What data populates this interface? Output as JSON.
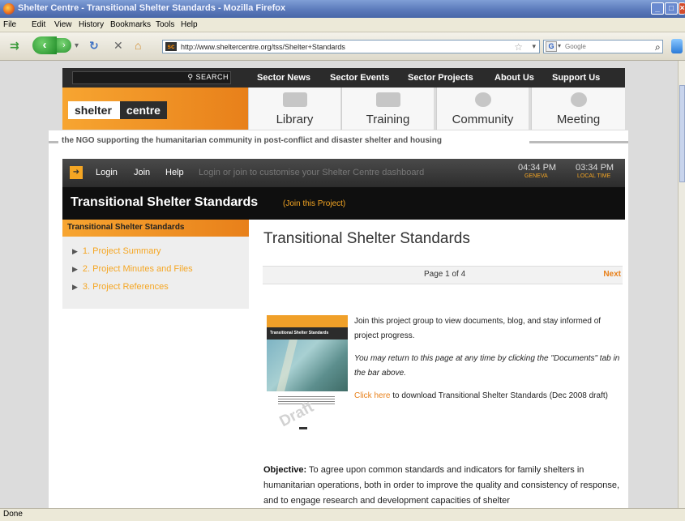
{
  "window": {
    "title": "Shelter Centre - Transitional Shelter Standards - Mozilla Firefox"
  },
  "menu": [
    "File",
    "Edit",
    "View",
    "History",
    "Bookmarks",
    "Tools",
    "Help"
  ],
  "toolbar": {
    "url": "http://www.sheltercentre.org/tss/Shelter+Standards",
    "search_placeholder": "Google"
  },
  "site": {
    "search_button": "SEARCH",
    "top_nav": [
      "Sector News",
      "Sector Events",
      "Sector Projects",
      "About Us",
      "Support Us"
    ],
    "logo_left": "shelter",
    "logo_right": "centre",
    "tabs": [
      "Library",
      "Training",
      "Community",
      "Meeting"
    ],
    "tagline": "the NGO supporting the humanitarian community in post-conflict and disaster shelter and housing",
    "user_bar": {
      "icon": "➜",
      "login": "Login",
      "join": "Join",
      "help": "Help",
      "message": "Login or join to customise your Shelter Centre dashboard",
      "time_geneva": "04:34 PM",
      "geneva_label": "GENEVA",
      "time_local": "03:34 PM",
      "local_label": "LOCAL TIME"
    },
    "project": {
      "title": "Transitional Shelter Standards",
      "join_link": "(Join this Project)"
    },
    "sidebar": {
      "heading": "Transitional Shelter Standards",
      "items": [
        "1. Project Summary",
        "2. Project Minutes and Files",
        "3. Project References"
      ]
    },
    "main": {
      "title": "Transitional Shelter Standards",
      "page_label": "Page 1 of 4",
      "next_label": "Next",
      "cover_title": "Transitional Shelter Standards",
      "cover_watermark": "Draft",
      "intro1": "Join this project group to view documents, blog, and stay informed of project progress.",
      "intro2": "You may return to this page at any time by clicking the \"Documents\" tab in the bar above.",
      "click_here": "Click here",
      "intro3_rest": " to download Transitional Shelter Standards (Dec 2008 draft)",
      "objective_label": "Objective:",
      "objective_text": " To agree upon common standards and indicators for family shelters in humanitarian operations, both in order to improve the quality and consistency of response, and to engage research and development capacities of shelter"
    }
  },
  "status": {
    "text": "Done"
  }
}
